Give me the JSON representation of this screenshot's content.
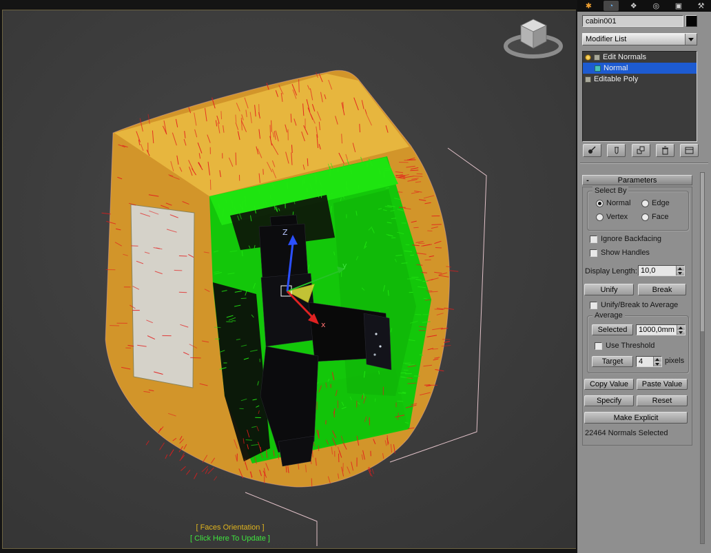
{
  "viewport": {
    "gizmo": {
      "z_label": "Z",
      "y_label": "y",
      "x_label": "x"
    },
    "overlay": {
      "line1": "[ Faces Orientation ]",
      "line1_color": "#e0b41e",
      "line2": "[ Click Here To Update ]",
      "line2_color": "#3fe43f"
    },
    "colors": {
      "background": "#3e3e3e",
      "cabin": "#d2952a",
      "cabin_top": "#e7b63e",
      "window": "#d5d2c9",
      "selection_green": "#15cf0b",
      "normal_red": "#e41c1c",
      "normal_green": "#22e812",
      "gizmo_x": "#e02222",
      "gizmo_y": "#27c427",
      "gizmo_z": "#2b4fff",
      "wireframe": "#ffd9e2"
    }
  },
  "panel": {
    "tabs": [
      {
        "name": "create",
        "glyph": "✱"
      },
      {
        "name": "modify",
        "glyph": "◔"
      },
      {
        "name": "hierarchy",
        "glyph": "❖"
      },
      {
        "name": "motion",
        "glyph": "◎"
      },
      {
        "name": "display",
        "glyph": "▣"
      },
      {
        "name": "utilities",
        "glyph": "⚒"
      }
    ],
    "object_name": "cabin001",
    "modifier_list_label": "Modifier List",
    "stack": {
      "rows": [
        {
          "label": "Edit Normals"
        },
        {
          "label": "Normal"
        },
        {
          "label": "Editable Poly"
        }
      ]
    },
    "parameters": {
      "title": "Parameters",
      "collapse_glyph": "-",
      "select_by": {
        "label": "Select By",
        "options": [
          {
            "label": "Normal",
            "checked": true
          },
          {
            "label": "Edge",
            "checked": false
          },
          {
            "label": "Vertex",
            "checked": false
          },
          {
            "label": "Face",
            "checked": false
          }
        ]
      },
      "ignore_backfacing": {
        "label": "Ignore Backfacing",
        "checked": false
      },
      "show_handles": {
        "label": "Show Handles",
        "checked": false
      },
      "display_length": {
        "label": "Display Length:",
        "value": "10,0"
      },
      "unify": "Unify",
      "break": "Break",
      "unify_break_avg": {
        "label": "Unify/Break to Average",
        "checked": false
      },
      "average": {
        "label": "Average",
        "selected_button": "Selected",
        "selected_value": "1000,0mm",
        "use_threshold": {
          "label": "Use Threshold",
          "checked": false
        },
        "target_button": "Target",
        "target_value": "4",
        "target_unit": "pixels"
      },
      "copy_value": "Copy Value",
      "paste_value": "Paste Value",
      "specify": "Specify",
      "reset": "Reset",
      "make_explicit": "Make Explicit",
      "status": "22464 Normals Selected"
    }
  }
}
